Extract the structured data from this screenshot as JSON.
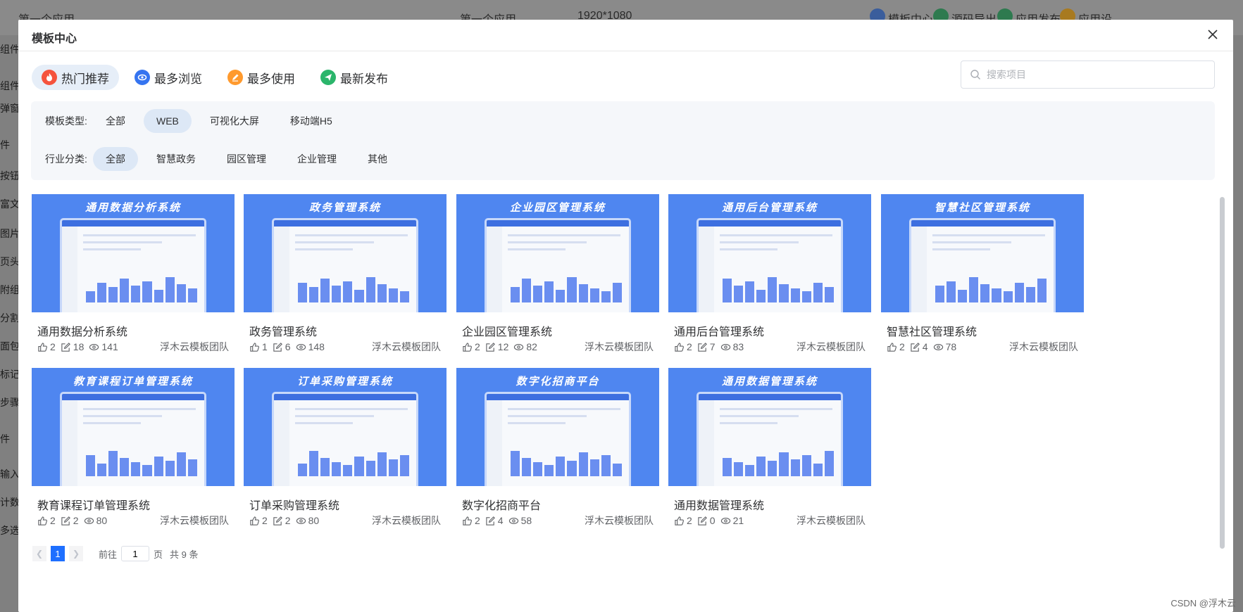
{
  "background": {
    "app_name": "第一个应用",
    "app_select": "第一个应用",
    "resolution": "1920*1080",
    "top_right": [
      "模板中心",
      "源码导出",
      "应用发布",
      "应用设"
    ],
    "side_labels": [
      "组件",
      "组件",
      "弹窗",
      "件",
      "按钮",
      "富文",
      "图片",
      "页头",
      "附组",
      "分割",
      "面包",
      "标记",
      "步骤",
      "件",
      "输入",
      "计数",
      "多选"
    ]
  },
  "modal": {
    "title": "模板中心",
    "sort_tabs": [
      {
        "label": "热门推荐",
        "icon": "fire-icon",
        "color": "#f5533d"
      },
      {
        "label": "最多浏览",
        "icon": "eye-icon",
        "color": "#3574f0"
      },
      {
        "label": "最多使用",
        "icon": "edit-icon",
        "color": "#ff9a2e"
      },
      {
        "label": "最新发布",
        "icon": "send-icon",
        "color": "#2bb56b"
      }
    ],
    "search_placeholder": "搜索项目",
    "filters": {
      "type_label": "模板类型:",
      "type_options": [
        "全部",
        "WEB",
        "可视化大屏",
        "移动端H5"
      ],
      "type_selected": "WEB",
      "industry_label": "行业分类:",
      "industry_options": [
        "全部",
        "智慧政务",
        "园区管理",
        "企业管理",
        "其他"
      ],
      "industry_selected": "全部"
    },
    "cards": [
      {
        "title": "通用数据分析系统",
        "likes": "2",
        "uses": "18",
        "views": "141",
        "team": "浮木云模板团队"
      },
      {
        "title": "政务管理系统",
        "likes": "1",
        "uses": "6",
        "views": "148",
        "team": "浮木云模板团队"
      },
      {
        "title": "企业园区管理系统",
        "likes": "2",
        "uses": "12",
        "views": "82",
        "team": "浮木云模板团队"
      },
      {
        "title": "通用后台管理系统",
        "likes": "2",
        "uses": "7",
        "views": "83",
        "team": "浮木云模板团队"
      },
      {
        "title": "智慧社区管理系统",
        "likes": "2",
        "uses": "4",
        "views": "78",
        "team": "浮木云模板团队"
      },
      {
        "title": "教育课程订单管理系统",
        "likes": "2",
        "uses": "2",
        "views": "80",
        "team": "浮木云模板团队"
      },
      {
        "title": "订单采购管理系统",
        "likes": "2",
        "uses": "2",
        "views": "80",
        "team": "浮木云模板团队"
      },
      {
        "title": "数字化招商平台",
        "likes": "2",
        "uses": "4",
        "views": "58",
        "team": "浮木云模板团队"
      },
      {
        "title": "通用数据管理系统",
        "likes": "2",
        "uses": "0",
        "views": "21",
        "team": "浮木云模板团队"
      }
    ],
    "pagination": {
      "current": "1",
      "goto_prefix": "前往",
      "goto_value": "1",
      "goto_suffix": "页",
      "total": "共 9 条"
    }
  },
  "watermark": "CSDN @浮木云",
  "colors": {
    "accent": "#1e6fff",
    "thumb_bg": "#4f86f0",
    "active_pill": "#dde8f6"
  }
}
